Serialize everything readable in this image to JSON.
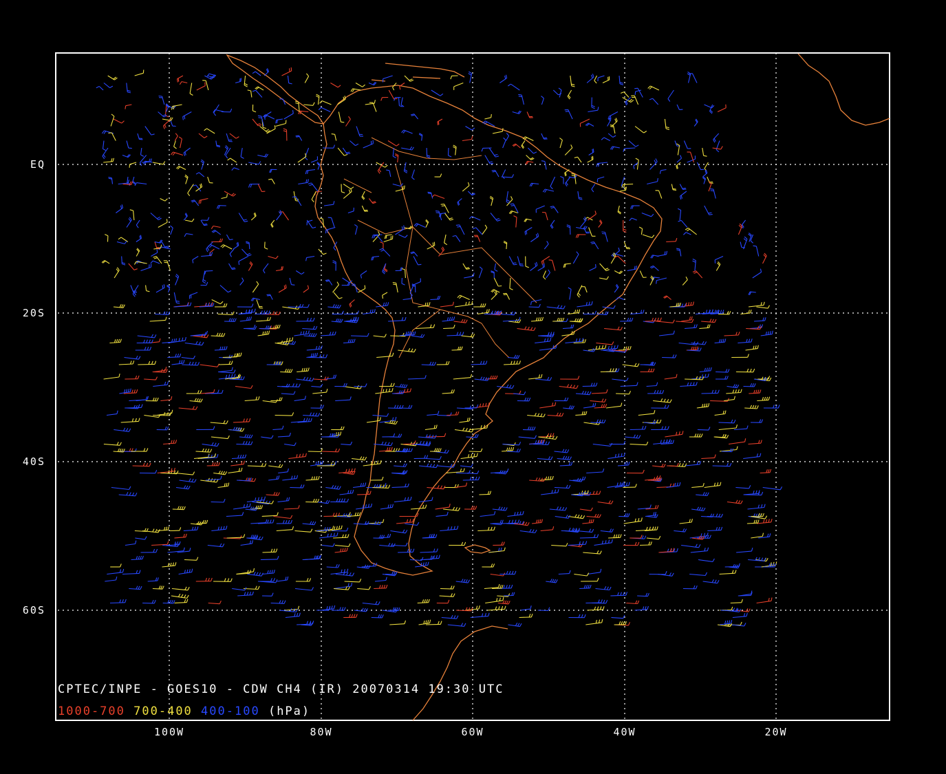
{
  "map": {
    "caption": "CPTEC/INPE - GOES10 - CDW CH4 (IR) 20070314 19:30 UTC",
    "lat_labels": [
      "EQ",
      "20S",
      "40S",
      "60S"
    ],
    "lon_labels": [
      "100W",
      "80W",
      "60W",
      "40W",
      "20W"
    ],
    "legend": {
      "low": "1000-700",
      "mid": "700-400",
      "high": "400-100",
      "unit": "(hPa)"
    },
    "colors": {
      "background": "#000000",
      "frame": "#ffffff",
      "coastline": "#e8823a",
      "low_level": "#e8402a",
      "mid_level": "#f0e040",
      "high_level": "#2848ff",
      "grid": "#ffffff"
    }
  }
}
